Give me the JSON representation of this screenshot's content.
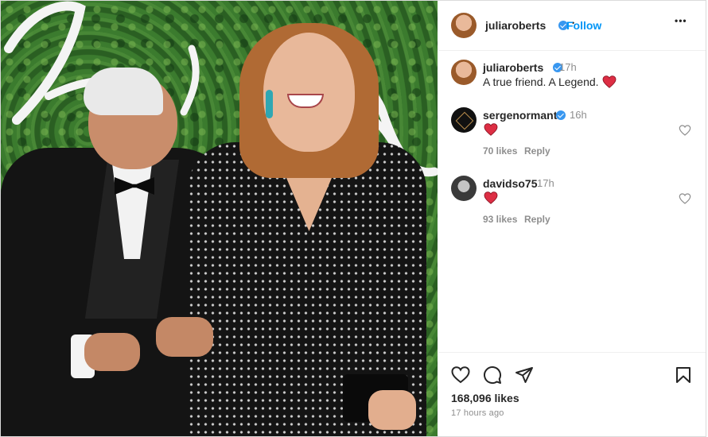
{
  "post": {
    "author": {
      "username": "juliaroberts",
      "verified": true,
      "follow_label": "Follow",
      "separator": "•",
      "more_icon": "more-horizontal-icon",
      "more_label": "•••"
    },
    "photo": {
      "subject": "photo"
    }
  },
  "caption": {
    "username": "juliaroberts",
    "time": "17h",
    "text": "A true friend. A Legend.",
    "emoji": "red-heart"
  },
  "comments": [
    {
      "username": "sergenormant",
      "verified": true,
      "time": "16h",
      "emoji": "red-heart",
      "likes": "70 likes",
      "reply_label": "Reply"
    },
    {
      "username": "davidso75",
      "verified": false,
      "time": "17h",
      "emoji": "red-heart",
      "likes": "93 likes",
      "reply_label": "Reply"
    }
  ],
  "actions": {
    "icons": [
      "heart-outline-icon",
      "comment-icon",
      "share-icon",
      "bookmark-icon"
    ],
    "likes_count": "168,096 likes",
    "posted_ago": "17 hours ago"
  },
  "colors": {
    "link": "#0095f6",
    "verified": "#3897f0",
    "heart": "#ed4956",
    "secondary_text": "#8e8e8e"
  }
}
